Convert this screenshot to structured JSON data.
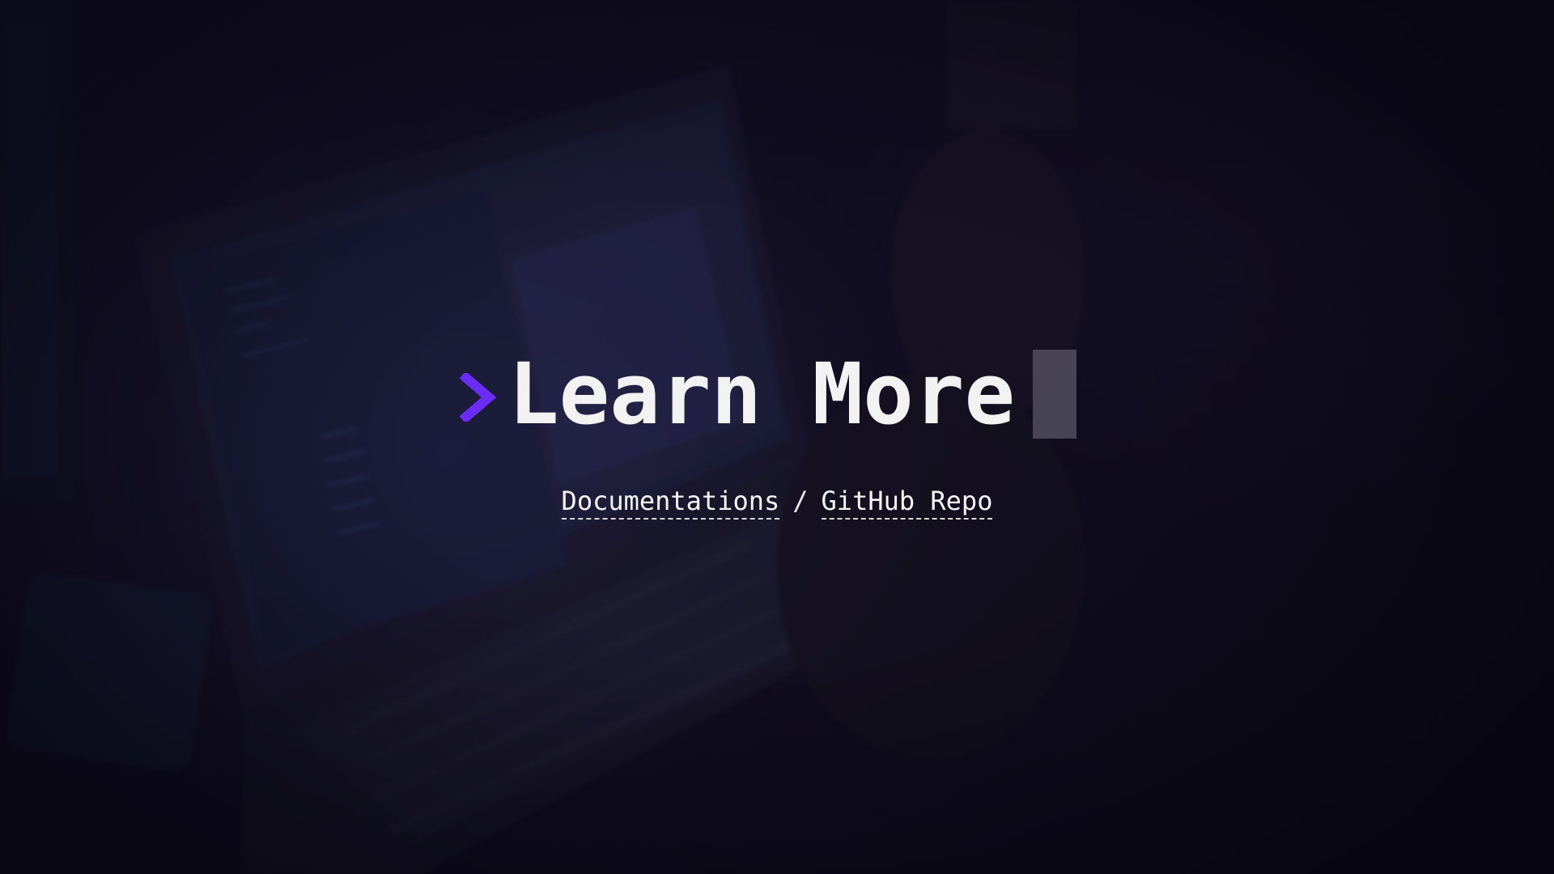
{
  "hero": {
    "title": "Learn More",
    "prompt_icon": "chevron-right-icon",
    "accent_color": "#6b2cf5",
    "cursor_color": "#4b4858"
  },
  "links": {
    "documentation_label": "Documentations",
    "separator": "/",
    "github_label": "GitHub Repo"
  }
}
